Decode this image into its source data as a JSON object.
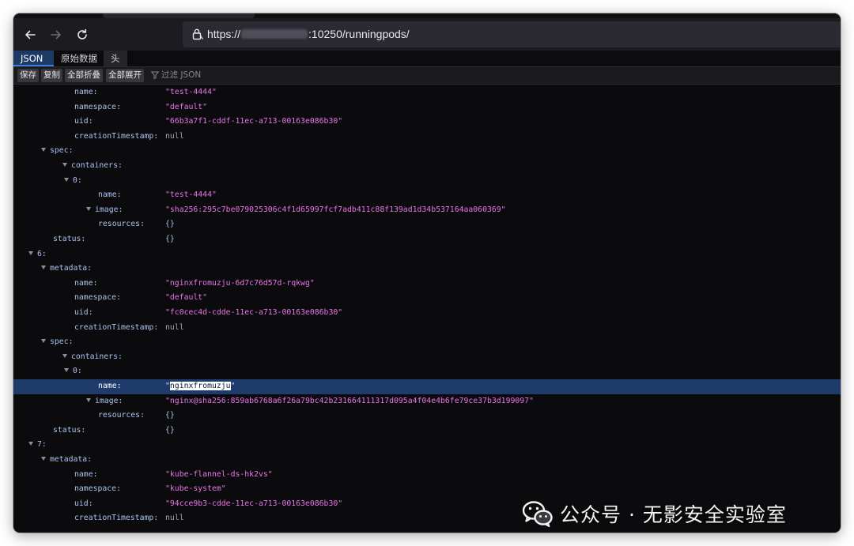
{
  "browser": {
    "url_prefix": "https://",
    "url_suffix": ":10250/runningpods/"
  },
  "viewer_tabs": [
    {
      "label": "JSON",
      "active": true
    },
    {
      "label": "原始数据",
      "active": false
    },
    {
      "label": "头",
      "active": false
    }
  ],
  "toolbar": {
    "save": "保存",
    "copy": "复制",
    "collapse_all": "全部折叠",
    "expand_all": "全部展开",
    "filter_placeholder": "过滤 JSON"
  },
  "rows": [
    {
      "indent": 3,
      "key": "name:",
      "value": "\"test-4444\"",
      "kind": "str"
    },
    {
      "indent": 3,
      "key": "namespace:",
      "value": "\"default\"",
      "kind": "str"
    },
    {
      "indent": 3,
      "key": "uid:",
      "value": "\"66b3a7f1-cddf-11ec-a713-00163e086b30\"",
      "kind": "str"
    },
    {
      "indent": 3,
      "key": "creationTimestamp:",
      "value": "null",
      "kind": "nul"
    },
    {
      "indent": 2,
      "key": "spec:",
      "toggle": true
    },
    {
      "indent": 3,
      "key": "containers:",
      "toggle": true
    },
    {
      "indent": 4,
      "key": "0:",
      "toggle": true
    },
    {
      "indent": 5,
      "key": "name:",
      "value": "\"test-4444\"",
      "kind": "str"
    },
    {
      "indent": 5,
      "key": "image:",
      "toggle": true,
      "value": "\"sha256:295c7be079025306c4f1d65997fcf7adb411c88f139ad1d34b537164aa060369\"",
      "kind": "str"
    },
    {
      "indent": 5,
      "key": "resources:",
      "value": "{}",
      "kind": "obj"
    },
    {
      "indent": 2,
      "key": "status:",
      "value": "{}",
      "kind": "obj"
    },
    {
      "indent": 1,
      "key": "6:",
      "toggle": true
    },
    {
      "indent": 2,
      "key": "metadata:",
      "toggle": true
    },
    {
      "indent": 3,
      "key": "name:",
      "value": "\"nginxfromuzju-6d7c76d57d-rqkwg\"",
      "kind": "str"
    },
    {
      "indent": 3,
      "key": "namespace:",
      "value": "\"default\"",
      "kind": "str"
    },
    {
      "indent": 3,
      "key": "uid:",
      "value": "\"fc0cec4d-cdde-11ec-a713-00163e086b30\"",
      "kind": "str"
    },
    {
      "indent": 3,
      "key": "creationTimestamp:",
      "value": "null",
      "kind": "nul"
    },
    {
      "indent": 2,
      "key": "spec:",
      "toggle": true
    },
    {
      "indent": 3,
      "key": "containers:",
      "toggle": true
    },
    {
      "indent": 4,
      "key": "0:",
      "toggle": true
    },
    {
      "indent": 5,
      "key": "name:",
      "value": "\"nginxfromuzju\"",
      "kind": "str",
      "highlight": true,
      "selected_text": "nginxfromuzju"
    },
    {
      "indent": 5,
      "key": "image:",
      "toggle": true,
      "value": "\"nginx@sha256:859ab6768a6f26a79bc42b231664111317d095a4f04e4b6fe79ce37b3d199097\"",
      "kind": "str"
    },
    {
      "indent": 5,
      "key": "resources:",
      "value": "{}",
      "kind": "obj"
    },
    {
      "indent": 2,
      "key": "status:",
      "value": "{}",
      "kind": "obj"
    },
    {
      "indent": 1,
      "key": "7:",
      "toggle": true
    },
    {
      "indent": 2,
      "key": "metadata:",
      "toggle": true
    },
    {
      "indent": 3,
      "key": "name:",
      "value": "\"kube-flannel-ds-hk2vs\"",
      "kind": "str"
    },
    {
      "indent": 3,
      "key": "namespace:",
      "value": "\"kube-system\"",
      "kind": "str"
    },
    {
      "indent": 3,
      "key": "uid:",
      "value": "\"94cce9b3-cdde-11ec-a713-00163e086b30\"",
      "kind": "str"
    },
    {
      "indent": 3,
      "key": "creationTimestamp:",
      "value": "null",
      "kind": "nul"
    }
  ],
  "watermark": {
    "text": "公众号 · 无影安全实验室"
  },
  "colors": {
    "string": "#ea74ea",
    "key": "#a8c4f0",
    "highlight_row": "#1f3b6c",
    "active_tab": "#1d3a67"
  }
}
